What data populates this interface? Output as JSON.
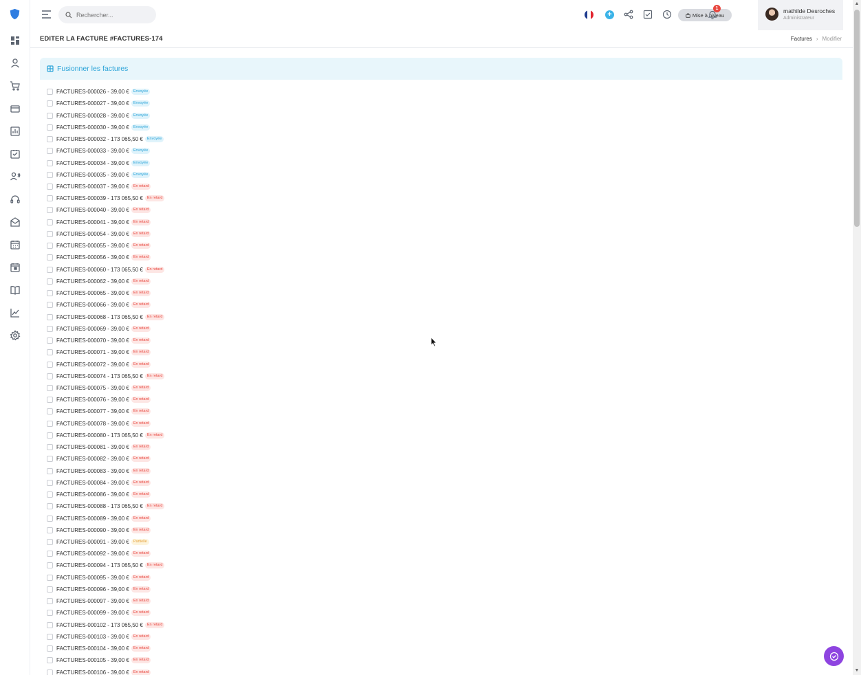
{
  "search": {
    "placeholder": "Rechercher..."
  },
  "topbar": {
    "upgrade_label": "Mise à niveau",
    "notification_count": "1"
  },
  "user": {
    "name": "mathilde Desroches",
    "role": "Administrateur"
  },
  "page": {
    "title": "EDITER LA FACTURE #FACTURES-174",
    "breadcrumb": {
      "parent": "Factures",
      "separator": "›",
      "current": "Modifier"
    }
  },
  "card": {
    "title": "Fusionner les factures"
  },
  "status_colors": {
    "Envoyée": {
      "bg": "#dff3fb",
      "fg": "#2aa3d8"
    },
    "En retard": {
      "bg": "#fde6e4",
      "fg": "#e8473f"
    },
    "Partielle": {
      "bg": "#fdf4dc",
      "fg": "#e6a23c"
    }
  },
  "invoices": [
    {
      "label": "FACTURES-000026 - 39,00 €",
      "status": "Envoyée"
    },
    {
      "label": "FACTURES-000027 - 39,00 €",
      "status": "Envoyée"
    },
    {
      "label": "FACTURES-000028 - 39,00 €",
      "status": "Envoyée"
    },
    {
      "label": "FACTURES-000030 - 39,00 €",
      "status": "Envoyée"
    },
    {
      "label": "FACTURES-000032 - 173 065,50 €",
      "status": "Envoyée"
    },
    {
      "label": "FACTURES-000033 - 39,00 €",
      "status": "Envoyée"
    },
    {
      "label": "FACTURES-000034 - 39,00 €",
      "status": "Envoyée"
    },
    {
      "label": "FACTURES-000035 - 39,00 €",
      "status": "Envoyée"
    },
    {
      "label": "FACTURES-000037 - 39,00 €",
      "status": "En retard"
    },
    {
      "label": "FACTURES-000039 - 173 065,50 €",
      "status": "En retard"
    },
    {
      "label": "FACTURES-000040 - 39,00 €",
      "status": "En retard"
    },
    {
      "label": "FACTURES-000041 - 39,00 €",
      "status": "En retard"
    },
    {
      "label": "FACTURES-000054 - 39,00 €",
      "status": "En retard"
    },
    {
      "label": "FACTURES-000055 - 39,00 €",
      "status": "En retard"
    },
    {
      "label": "FACTURES-000056 - 39,00 €",
      "status": "En retard"
    },
    {
      "label": "FACTURES-000060 - 173 065,50 €",
      "status": "En retard"
    },
    {
      "label": "FACTURES-000062 - 39,00 €",
      "status": "En retard"
    },
    {
      "label": "FACTURES-000065 - 39,00 €",
      "status": "En retard"
    },
    {
      "label": "FACTURES-000066 - 39,00 €",
      "status": "En retard"
    },
    {
      "label": "FACTURES-000068 - 173 065,50 €",
      "status": "En retard"
    },
    {
      "label": "FACTURES-000069 - 39,00 €",
      "status": "En retard"
    },
    {
      "label": "FACTURES-000070 - 39,00 €",
      "status": "En retard"
    },
    {
      "label": "FACTURES-000071 - 39,00 €",
      "status": "En retard"
    },
    {
      "label": "FACTURES-000072 - 39,00 €",
      "status": "En retard"
    },
    {
      "label": "FACTURES-000074 - 173 065,50 €",
      "status": "En retard"
    },
    {
      "label": "FACTURES-000075 - 39,00 €",
      "status": "En retard"
    },
    {
      "label": "FACTURES-000076 - 39,00 €",
      "status": "En retard"
    },
    {
      "label": "FACTURES-000077 - 39,00 €",
      "status": "En retard"
    },
    {
      "label": "FACTURES-000078 - 39,00 €",
      "status": "En retard"
    },
    {
      "label": "FACTURES-000080 - 173 065,50 €",
      "status": "En retard"
    },
    {
      "label": "FACTURES-000081 - 39,00 €",
      "status": "En retard"
    },
    {
      "label": "FACTURES-000082 - 39,00 €",
      "status": "En retard"
    },
    {
      "label": "FACTURES-000083 - 39,00 €",
      "status": "En retard"
    },
    {
      "label": "FACTURES-000084 - 39,00 €",
      "status": "En retard"
    },
    {
      "label": "FACTURES-000086 - 39,00 €",
      "status": "En retard"
    },
    {
      "label": "FACTURES-000088 - 173 065,50 €",
      "status": "En retard"
    },
    {
      "label": "FACTURES-000089 - 39,00 €",
      "status": "En retard"
    },
    {
      "label": "FACTURES-000090 - 39,00 €",
      "status": "En retard"
    },
    {
      "label": "FACTURES-000091 - 39,00 €",
      "status": "Partielle"
    },
    {
      "label": "FACTURES-000092 - 39,00 €",
      "status": "En retard"
    },
    {
      "label": "FACTURES-000094 - 173 065,50 €",
      "status": "En retard"
    },
    {
      "label": "FACTURES-000095 - 39,00 €",
      "status": "En retard"
    },
    {
      "label": "FACTURES-000096 - 39,00 €",
      "status": "En retard"
    },
    {
      "label": "FACTURES-000097 - 39,00 €",
      "status": "En retard"
    },
    {
      "label": "FACTURES-000099 - 39,00 €",
      "status": "En retard"
    },
    {
      "label": "FACTURES-000102 - 173 065,50 €",
      "status": "En retard"
    },
    {
      "label": "FACTURES-000103 - 39,00 €",
      "status": "En retard"
    },
    {
      "label": "FACTURES-000104 - 39,00 €",
      "status": "En retard"
    },
    {
      "label": "FACTURES-000105 - 39,00 €",
      "status": "En retard"
    },
    {
      "label": "FACTURES-000106 - 39,00 €",
      "status": "En retard"
    }
  ]
}
